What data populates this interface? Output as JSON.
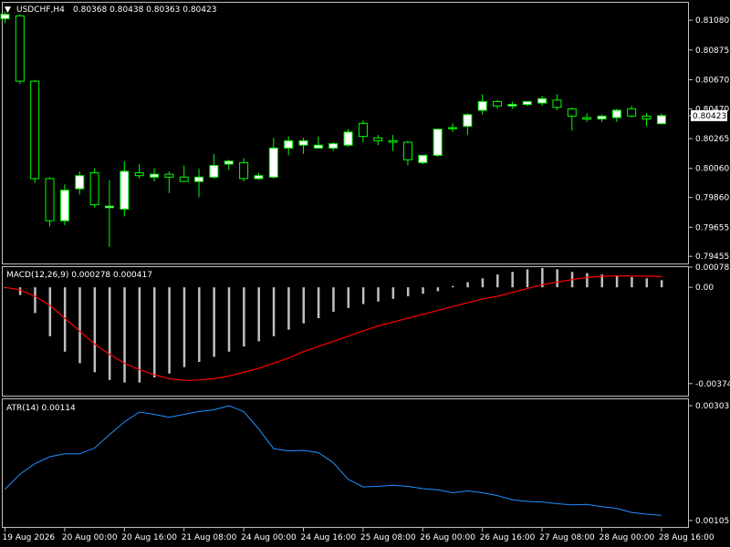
{
  "chart_data": [
    {
      "type": "candlestick",
      "title": "USDCHF,H4",
      "title_values": "0.80368 0.80438 0.80363 0.80423",
      "ylim": [
        0.79406,
        0.812
      ],
      "yticks": [
        "0.81080",
        "0.80875",
        "0.80670",
        "0.80470",
        "0.80265",
        "0.80060",
        "0.79860",
        "0.79655",
        "0.79455"
      ],
      "price_label": "0.80423",
      "current_price": 0.80423,
      "bull_color": "#ffffff",
      "wick_color": "#00ff00",
      "candles": [
        {
          "o": 0.8109,
          "h": 0.8114,
          "l": 0.8106,
          "c": 0.8112
        },
        {
          "o": 0.8111,
          "h": 0.8112,
          "l": 0.8064,
          "c": 0.8066
        },
        {
          "o": 0.8066,
          "h": 0.8067,
          "l": 0.7996,
          "c": 0.7999
        },
        {
          "o": 0.7999,
          "h": 0.8,
          "l": 0.7966,
          "c": 0.797
        },
        {
          "o": 0.797,
          "h": 0.7995,
          "l": 0.7967,
          "c": 0.7991
        },
        {
          "o": 0.7992,
          "h": 0.8004,
          "l": 0.7988,
          "c": 0.8001
        },
        {
          "o": 0.8003,
          "h": 0.8006,
          "l": 0.7979,
          "c": 0.7981
        },
        {
          "o": 0.7979,
          "h": 0.7998,
          "l": 0.7952,
          "c": 0.798
        },
        {
          "o": 0.7978,
          "h": 0.8011,
          "l": 0.7973,
          "c": 0.8004
        },
        {
          "o": 0.8003,
          "h": 0.8009,
          "l": 0.7999,
          "c": 0.8001
        },
        {
          "o": 0.8,
          "h": 0.8006,
          "l": 0.7997,
          "c": 0.8002
        },
        {
          "o": 0.8002,
          "h": 0.8004,
          "l": 0.7989,
          "c": 0.8
        },
        {
          "o": 0.8,
          "h": 0.8008,
          "l": 0.7998,
          "c": 0.7997
        },
        {
          "o": 0.7997,
          "h": 0.8006,
          "l": 0.7986,
          "c": 0.8
        },
        {
          "o": 0.8,
          "h": 0.8016,
          "l": 0.7999,
          "c": 0.8008
        },
        {
          "o": 0.8009,
          "h": 0.8012,
          "l": 0.8005,
          "c": 0.8011
        },
        {
          "o": 0.801,
          "h": 0.8013,
          "l": 0.7997,
          "c": 0.7999
        },
        {
          "o": 0.7999,
          "h": 0.8003,
          "l": 0.7998,
          "c": 0.8001
        },
        {
          "o": 0.8,
          "h": 0.8027,
          "l": 0.7999,
          "c": 0.802
        },
        {
          "o": 0.802,
          "h": 0.8028,
          "l": 0.8015,
          "c": 0.8025
        },
        {
          "o": 0.8022,
          "h": 0.8027,
          "l": 0.8016,
          "c": 0.8025
        },
        {
          "o": 0.802,
          "h": 0.8028,
          "l": 0.802,
          "c": 0.8022
        },
        {
          "o": 0.802,
          "h": 0.8024,
          "l": 0.8018,
          "c": 0.8023
        },
        {
          "o": 0.8022,
          "h": 0.8033,
          "l": 0.8021,
          "c": 0.8031
        },
        {
          "o": 0.8037,
          "h": 0.8039,
          "l": 0.8024,
          "c": 0.8028
        },
        {
          "o": 0.8027,
          "h": 0.8029,
          "l": 0.8022,
          "c": 0.8025
        },
        {
          "o": 0.8025,
          "h": 0.8029,
          "l": 0.8018,
          "c": 0.8024
        },
        {
          "o": 0.8024,
          "h": 0.8025,
          "l": 0.8008,
          "c": 0.8012
        },
        {
          "o": 0.801,
          "h": 0.8015,
          "l": 0.8009,
          "c": 0.8015
        },
        {
          "o": 0.8015,
          "h": 0.8031,
          "l": 0.8014,
          "c": 0.8033
        },
        {
          "o": 0.8034,
          "h": 0.8037,
          "l": 0.8031,
          "c": 0.8034
        },
        {
          "o": 0.8035,
          "h": 0.8044,
          "l": 0.8029,
          "c": 0.8043
        },
        {
          "o": 0.8046,
          "h": 0.8057,
          "l": 0.8043,
          "c": 0.8052
        },
        {
          "o": 0.8052,
          "h": 0.8053,
          "l": 0.8047,
          "c": 0.8049
        },
        {
          "o": 0.8049,
          "h": 0.8052,
          "l": 0.8047,
          "c": 0.805
        },
        {
          "o": 0.805,
          "h": 0.8052,
          "l": 0.8049,
          "c": 0.8052
        },
        {
          "o": 0.8051,
          "h": 0.8056,
          "l": 0.8049,
          "c": 0.8054
        },
        {
          "o": 0.8053,
          "h": 0.8057,
          "l": 0.8046,
          "c": 0.8048
        },
        {
          "o": 0.8047,
          "h": 0.8048,
          "l": 0.8032,
          "c": 0.8042
        },
        {
          "o": 0.8041,
          "h": 0.8044,
          "l": 0.8038,
          "c": 0.804
        },
        {
          "o": 0.804,
          "h": 0.8043,
          "l": 0.8038,
          "c": 0.8042
        },
        {
          "o": 0.8041,
          "h": 0.8047,
          "l": 0.8038,
          "c": 0.8046
        },
        {
          "o": 0.8047,
          "h": 0.8049,
          "l": 0.8041,
          "c": 0.8042
        },
        {
          "o": 0.8042,
          "h": 0.8044,
          "l": 0.8035,
          "c": 0.804
        },
        {
          "o": 0.80368,
          "h": 0.80438,
          "l": 0.80363,
          "c": 0.80423
        }
      ]
    },
    {
      "type": "bar",
      "title": "MACD(12,26,9) 0.000278 0.000417",
      "ylim": [
        -0.00421,
        0.000785
      ],
      "yticks": [
        "0.000785",
        "0.00",
        "-0.003742"
      ],
      "bar_color": "#c0c0c0",
      "signal_color": "#ff0000",
      "values": [
        0.0,
        -0.0003,
        -0.001,
        -0.0019,
        -0.0025,
        -0.00295,
        -0.0033,
        -0.0036,
        -0.0037,
        -0.0037,
        -0.0035,
        -0.00335,
        -0.0031,
        -0.0029,
        -0.0027,
        -0.0025,
        -0.0023,
        -0.0021,
        -0.0019,
        -0.00165,
        -0.0014,
        -0.0012,
        -0.00095,
        -0.0008,
        -0.00065,
        -0.00055,
        -0.00045,
        -0.00035,
        -0.00025,
        -0.00015,
        5e-05,
        0.0002,
        0.00035,
        0.0005,
        0.0006,
        0.0007,
        0.00075,
        0.0007,
        0.0006,
        0.00055,
        0.0005,
        0.00045,
        0.0004,
        0.00035,
        0.000278
      ],
      "signal": [
        0.0,
        -0.0001,
        -0.00035,
        -0.0007,
        -0.0012,
        -0.0017,
        -0.0022,
        -0.0026,
        -0.00295,
        -0.0032,
        -0.0034,
        -0.00355,
        -0.00362,
        -0.0036,
        -0.00355,
        -0.00345,
        -0.0033,
        -0.00315,
        -0.00295,
        -0.00275,
        -0.0025,
        -0.0023,
        -0.0021,
        -0.0019,
        -0.0017,
        -0.0015,
        -0.00135,
        -0.0012,
        -0.00105,
        -0.0009,
        -0.00075,
        -0.0006,
        -0.00045,
        -0.00035,
        -0.0002,
        -5e-05,
        0.0001,
        0.0002,
        0.0003,
        0.00038,
        0.00043,
        0.00045,
        0.00044,
        0.00043,
        0.000417
      ]
    },
    {
      "type": "line",
      "title": "ATR(14) 0.00114",
      "ylim": [
        0.00094,
        0.00314
      ],
      "yticks": [
        "0.00303",
        "0.00105"
      ],
      "line_color": "#1e90ff",
      "values": [
        0.00159,
        0.00185,
        0.00203,
        0.00215,
        0.0022,
        0.0022,
        0.0023,
        0.00253,
        0.00275,
        0.00292,
        0.00288,
        0.00283,
        0.00288,
        0.00293,
        0.00296,
        0.00303,
        0.00293,
        0.00263,
        0.00229,
        0.00225,
        0.00226,
        0.00222,
        0.00205,
        0.00176,
        0.00163,
        0.00164,
        0.00166,
        0.00164,
        0.0016,
        0.00158,
        0.00153,
        0.00156,
        0.00153,
        0.00148,
        0.00141,
        0.00138,
        0.00137,
        0.00134,
        0.00132,
        0.00133,
        0.00129,
        0.00126,
        0.00119,
        0.00116,
        0.00114
      ]
    }
  ],
  "x_axis_labels": [
    "19 Aug 2026",
    "20 Aug 00:00",
    "20 Aug 16:00",
    "21 Aug 08:00",
    "24 Aug 00:00",
    "24 Aug 16:00",
    "25 Aug 08:00",
    "26 Aug 00:00",
    "26 Aug 16:00",
    "27 Aug 08:00",
    "28 Aug 00:00",
    "28 Aug 16:00"
  ],
  "header_arrow": "▼"
}
